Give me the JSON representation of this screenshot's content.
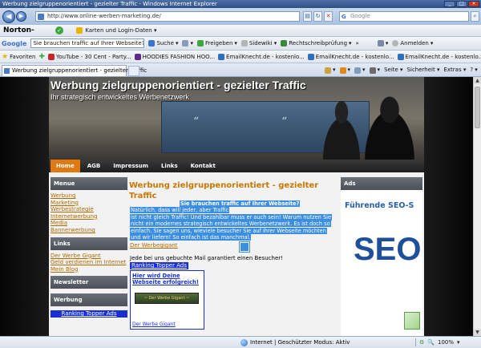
{
  "window": {
    "title": "Werbung zielgruppenorientiert - gezielter Traffic - Windows Internet Explorer",
    "controls": [
      "_",
      "□",
      "×"
    ]
  },
  "address_bar": {
    "url": "http://www.online-werben-marketing.de/",
    "search_placeholder": "Google",
    "search_brand": "G"
  },
  "norton_bar": {
    "logo": "Norton-",
    "item": "Karten und Login-Daten",
    "item_suffix": "▾"
  },
  "google_bar": {
    "logo": "Google",
    "query": "Sie brauchen traffic auf Ihrer Webseite?Na",
    "items": [
      "Suche",
      "Freigeben",
      "Sidewiki",
      "Rechtschreibprüfung",
      "»",
      "Anmelden"
    ]
  },
  "favorites_bar": {
    "favorites_label": "Favoriten",
    "items": [
      "YouTube - 30 Cent - Party...",
      "HOODIES  FASHION HOO...",
      "EmailKnecht.de - kostenlo...",
      "EmailKnecht.de - kostenlo...",
      "EmailKnecht.de - kostenlo..."
    ]
  },
  "tab_bar": {
    "active_tab": "Werbung zielgruppenorientiert - gezielter Traffic",
    "tools": [
      "Seite ▾",
      "Sicherheit ▾",
      "Extras ▾",
      "? ▾"
    ]
  },
  "site": {
    "title": "Werbung zielgruppenorientiert - gezielter Traffic",
    "subtitle": "Ihr strategisch entwickeltes Werbenetzwerk",
    "nav": [
      "Home",
      "AGB",
      "Impressum",
      "Links",
      "Kontakt"
    ],
    "nav_active": "Home",
    "left": {
      "menu_head": "Menue",
      "menu_items": [
        "Werbung",
        "Marketing",
        "Werbestrategie",
        "Internetwerbung",
        "Media",
        "Bannerwerbung"
      ],
      "links_head": "Links",
      "links_items": [
        "Der Werbe Gigant",
        "Geld verdienen im Internet",
        "Mein Blog"
      ],
      "newsletter_head": "Newsletter",
      "werbung_head": "Werbung",
      "werbung_link": "Ranking Topper Ads"
    },
    "main": {
      "title": "Werbung zielgruppenorientiert - gezielter Traffic",
      "highlight_lines": [
        "Sie brauchen traffic auf Ihrer Webseite?",
        "Natürlich, dass will jeder, aber Traffic",
        "ist nicht gleich Traffic! Und bezahlbar muss er auch sein! Warum nutzen Sie",
        "nicht ein modernes strategisch entwickeltes Werbenetzwerk. Es ist doch so",
        "einfach. Sie sagen uns, wieviele besucher Sie auf ihrer Webseite möchten",
        "und wir liefern! So einfach ist das manchmal."
      ],
      "highlight_link": "Der Werbegigant",
      "guarantee": "Jede bei uns gebuchte Mail garantiert einen Besucher!",
      "ranking_link": "Ranking Topper Ads",
      "adbox_title": "Hier wird Deine Webseite erfolgreich!",
      "adbox_banner": "~ Der Werbe Gigant ~",
      "adbox_link": "Der Werbe Gigant"
    },
    "right": {
      "ads_head": "Ads",
      "seo_title": "Führende SEO-S",
      "seo_big": "SEO"
    }
  },
  "status_bar": {
    "zone": "Internet | Geschützter Modus: Aktiv",
    "zoom": "100%",
    "zoom_arrow": "▾"
  },
  "colors": {
    "link": "#b06a00",
    "highlight": "#3b8ee0",
    "nav_active": "#e07a10",
    "box_head": "#5c6068"
  }
}
